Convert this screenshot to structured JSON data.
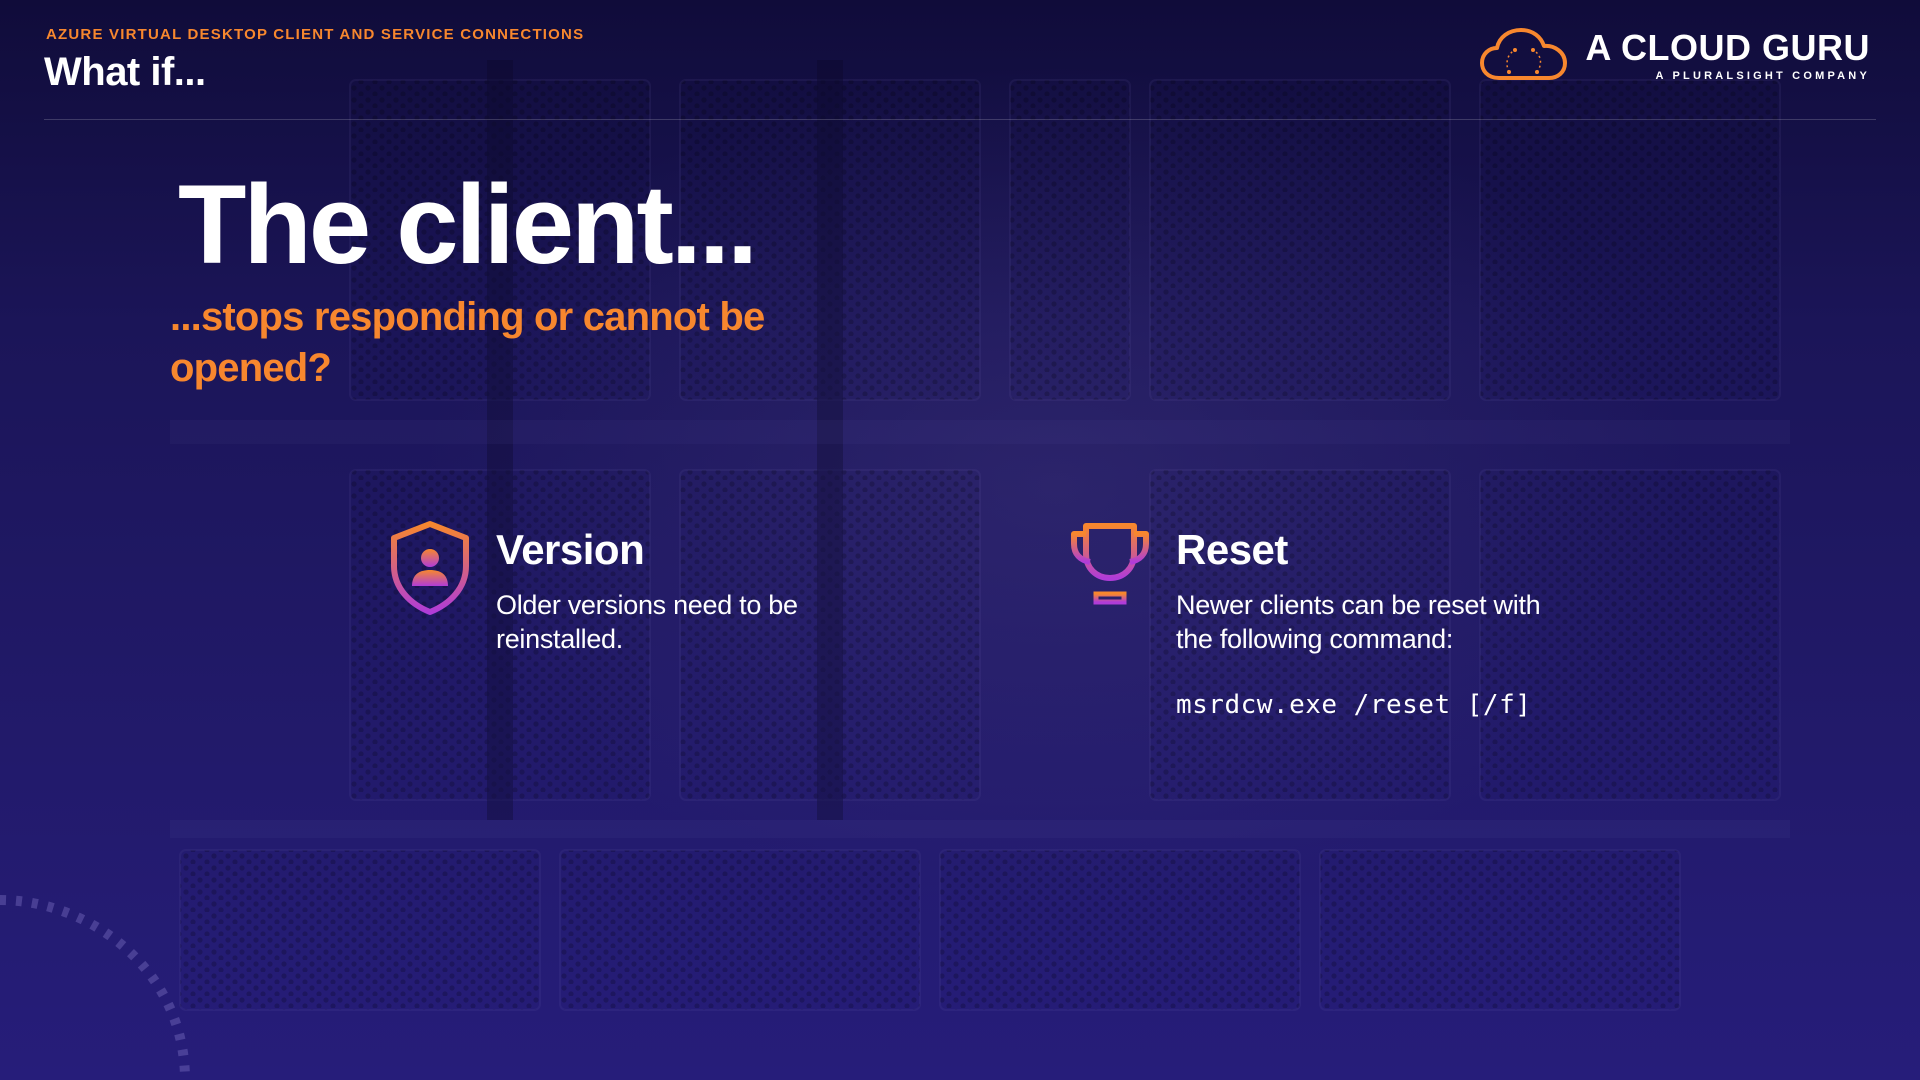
{
  "header": {
    "eyebrow": "AZURE VIRTUAL DESKTOP CLIENT AND SERVICE CONNECTIONS",
    "title": "What if..."
  },
  "logo": {
    "name": "A CLOUD GURU",
    "tagline": "A PLURALSIGHT COMPANY",
    "icon": "cloud-icon"
  },
  "hero": {
    "title": "The client...",
    "subtitle": "...stops responding or cannot be opened?"
  },
  "cards": [
    {
      "icon": "shield-user-icon",
      "heading": "Version",
      "text": "Older versions need to be reinstalled."
    },
    {
      "icon": "trophy-icon",
      "heading": "Reset",
      "text": "Newer clients can be reset with the following command:",
      "code": "msrdcw.exe /reset [/f]"
    }
  ],
  "colors": {
    "accent": "#f7872e",
    "accent_gradient_end": "#b03cd8",
    "background": "#1c1558",
    "text": "#ffffff"
  }
}
